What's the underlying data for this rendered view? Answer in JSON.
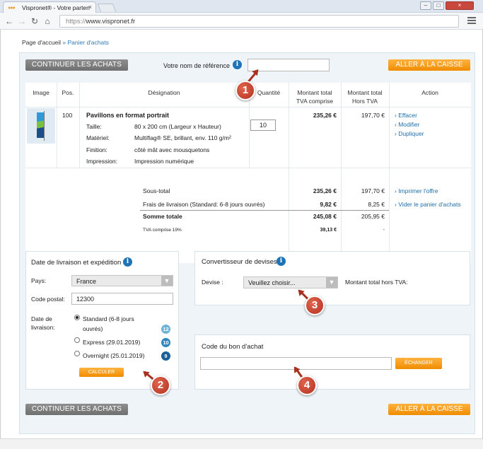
{
  "browser": {
    "tab_title": "Vispronet® - Votre parten",
    "tab_close": "×",
    "url_scheme": "https://",
    "url_host": "www.vispronet.fr",
    "win_min": "–",
    "win_max": "□",
    "win_close": "×",
    "back": "←",
    "forward": "→",
    "reload": "↻",
    "home": "⌂"
  },
  "breadcrumb": {
    "home": "Page d'accueil",
    "sep": "»",
    "current": "Panier d'achats"
  },
  "top_bar": {
    "continue_label": "CONTINUER LES ACHATS",
    "reference_label": "Votre nom de référence",
    "reference_value": "",
    "checkout_label": "ALLER À LA CAISSE"
  },
  "table": {
    "headers": {
      "image": "Image",
      "pos": "Pos.",
      "designation": "Désignation",
      "quantity": "Quantité",
      "total_ttc_1": "Montant total",
      "total_ttc_2": "TVA comprise",
      "total_ht_1": "Montant total",
      "total_ht_2": "Hors TVA",
      "action": "Action"
    },
    "item": {
      "pos": "100",
      "name": "Pavillons en format portrait",
      "specs": [
        {
          "label": "Taille:",
          "value": "80 x 200 cm (Largeur x Hauteur)"
        },
        {
          "label": "Matériel:",
          "value": "Multiflag® SE, brillant, env. 110 g/m²"
        },
        {
          "label": "Finition:",
          "value": "côté mât avec mousquetons"
        },
        {
          "label": "Impression:",
          "value": "Impression numérique"
        }
      ],
      "quantity": "10",
      "total_ttc": "235,26 €",
      "total_ht": "197,70 €",
      "actions": [
        "› Effacer",
        "› Modifier",
        "› Dupliquer"
      ]
    },
    "summary": {
      "subtotal_label": "Sous-total",
      "subtotal_ttc": "235,26 €",
      "subtotal_ht": "197,70 €",
      "shipping_label": "Frais de livraison (Standard: 6-8 jours ouvrés)",
      "shipping_ttc": "9,82 €",
      "shipping_ht": "8,25 €",
      "total_label": "Somme totale",
      "total_ttc": "245,08 €",
      "total_ht": "205,95 €",
      "vat_label": "TVA comprise 19%",
      "vat_ttc": "39,13 €",
      "vat_ht": "-",
      "print_link": "› Imprimer l'offre",
      "empty_link": "› Vider le panier d'achats"
    }
  },
  "delivery": {
    "title": "Date de livraison et expédition",
    "country_label": "Pays:",
    "country_value": "France",
    "postal_label": "Code postal:",
    "postal_value": "12300",
    "date_label_1": "Date de",
    "date_label_2": "livraison:",
    "options": [
      {
        "label_1": "Standard (6-8 jours",
        "label_2": "ouvrés)",
        "days": "12",
        "color": "#6cb3d9"
      },
      {
        "label_1": "Express (29.01.2019)",
        "days": "10",
        "color": "#2e86c0"
      },
      {
        "label_1": "Overnight (25.01.2019)",
        "days": "9",
        "color": "#1a5f97"
      }
    ],
    "calc_label": "CALCULER"
  },
  "currency": {
    "title": "Convertisseur de devises",
    "devise_label": "Devise :",
    "devise_value": "Veuillez choisir...",
    "total_label": "Montant total hors TVA:"
  },
  "voucher": {
    "title": "Code du bon d'achat",
    "value": "",
    "exchange_label": "ÉCHANGER"
  },
  "bottom_bar": {
    "continue_label": "CONTINUER LES ACHATS",
    "checkout_label": "ALLER À LA CAISSE"
  },
  "callouts": [
    "1",
    "2",
    "3",
    "4"
  ],
  "info_icon": "i",
  "icons": {
    "info": "info-icon",
    "select_arrow": "chevron-down-icon",
    "menu": "menu-icon"
  },
  "colors": {
    "accent": "#1e73b6",
    "orange": "#f5a11c",
    "callout": "#c23a26"
  }
}
